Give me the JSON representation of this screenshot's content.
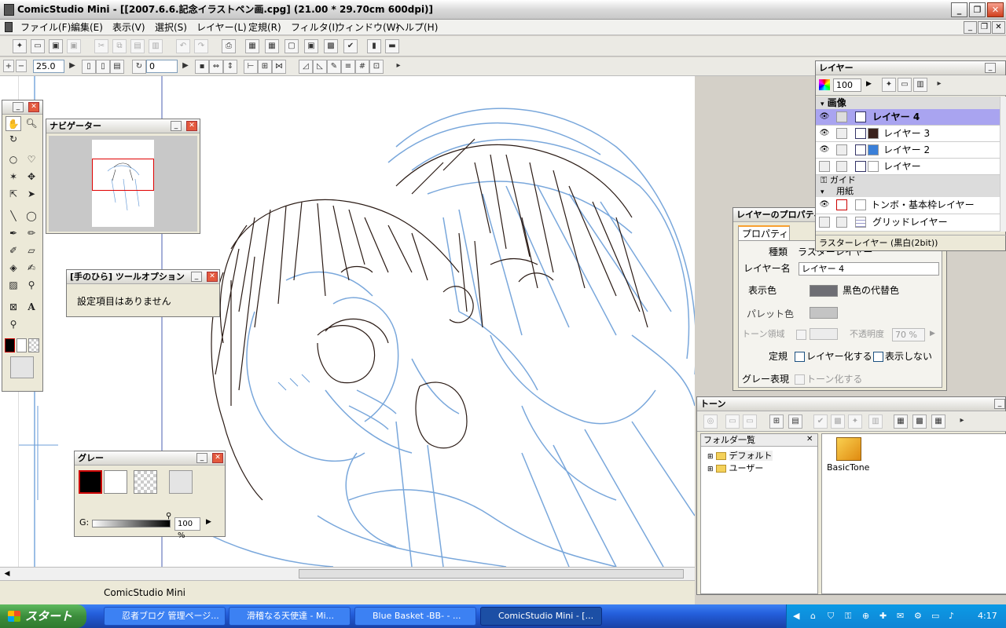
{
  "window": {
    "title": "ComicStudio Mini - [[2007.6.6.記念イラストペン画.cpg] (21.00 * 29.70cm 600dpi)]"
  },
  "menu": [
    "ファイル(F)",
    "編集(E)",
    "表示(V)",
    "選択(S)",
    "レイヤー(L)",
    "定規(R)",
    "フィルタ(I)",
    "ウィンドウ(W)",
    "ヘルプ(H)"
  ],
  "toolbar2": {
    "zoom": "25.0",
    "rotate": "0"
  },
  "status": {
    "text": "ComicStudio Mini"
  },
  "tools_panel": {
    "title": ""
  },
  "navigator": {
    "title": "ナビゲーター"
  },
  "tool_option": {
    "title": "[手のひら] ツールオプション",
    "message": "設定項目はありません"
  },
  "gray": {
    "title": "グレー",
    "g_label": "G:",
    "value": "100 %"
  },
  "layers": {
    "title": "レイヤー",
    "opacity": "100",
    "groups": {
      "image": "画像",
      "guide": "ガイド",
      "paper": "用紙"
    },
    "items": [
      {
        "name": "レイヤー 4",
        "selected": true,
        "visible": true
      },
      {
        "name": "レイヤー 3",
        "selected": false,
        "visible": true
      },
      {
        "name": "レイヤー 2",
        "selected": false,
        "visible": true
      },
      {
        "name": "レイヤー",
        "selected": false,
        "visible": false
      }
    ],
    "paper_items": [
      "トンボ・基本枠レイヤー",
      "グリッドレイヤー"
    ],
    "footer": "ラスターレイヤー (黒白(2bit))"
  },
  "layer_props": {
    "title": "レイヤーのプロパティ",
    "tab": "プロパティ",
    "kind_label": "種類",
    "kind_value": "ラスターレイヤー",
    "name_label": "レイヤー名",
    "name_value": "レイヤー 4",
    "display_color_label": "表示色",
    "display_color_value": "黒色の代替色",
    "palette_color_label": "パレット色",
    "tone_area_label": "トーン領域",
    "opacity_label": "不透明度",
    "opacity_value": "70 %",
    "ruler_label": "定規",
    "make_layer": "レイヤー化する",
    "hide": "表示しない",
    "gray_label": "グレー表現",
    "tone_convert": "トーン化する"
  },
  "tone": {
    "title": "トーン",
    "folder_list": "フォルダ一覧",
    "folders": [
      "デフォルト",
      "ユーザー"
    ],
    "item": "BasicTone"
  },
  "taskbar": {
    "start": "スタート",
    "tasks": [
      "忍者ブログ 管理ページ...",
      "滑稽なる天使達 - Mi...",
      "Blue Basket -BB- - ...",
      "ComicStudio Mini - [..."
    ],
    "time": "4:17"
  },
  "colors": {
    "sketch_blue": "#6b9ed8",
    "ink": "#2a1a14",
    "selection": "#a9a4f0"
  }
}
